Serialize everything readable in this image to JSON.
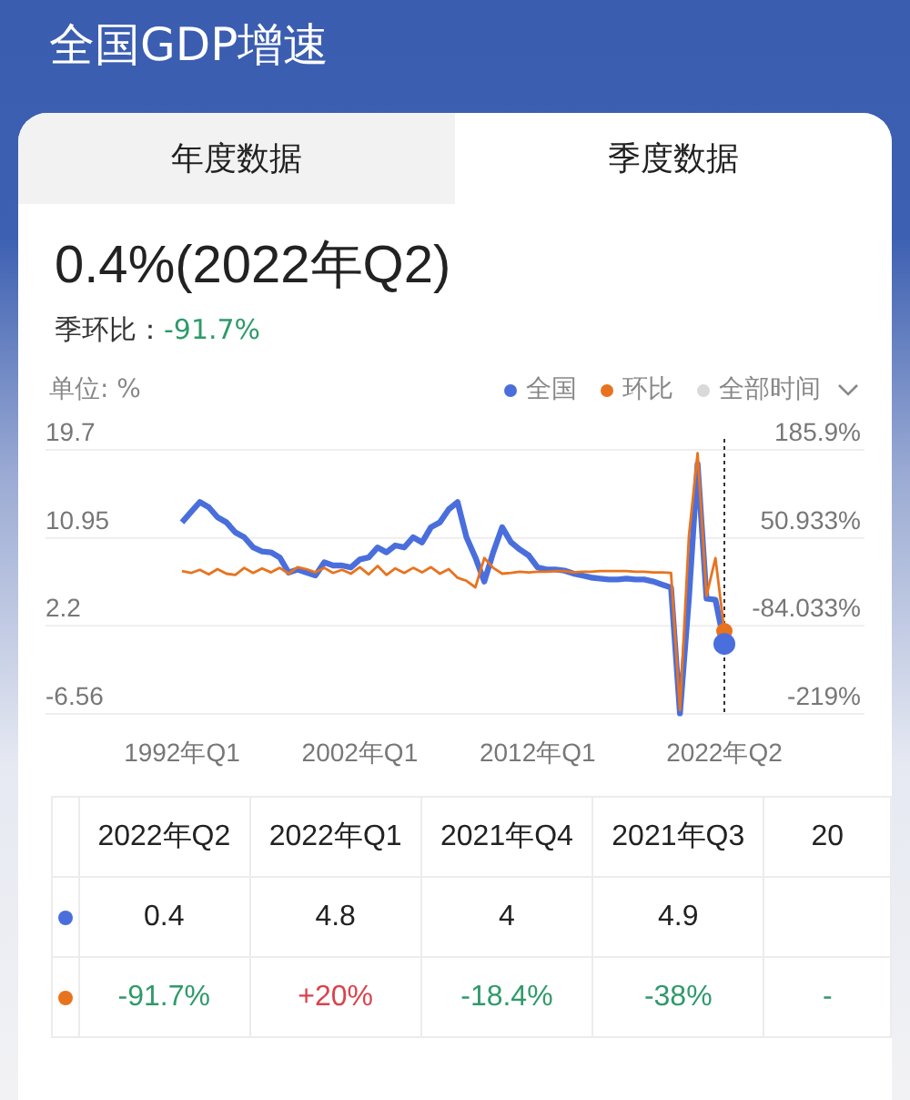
{
  "title": "全国GDP增速",
  "tabs": [
    {
      "label": "年度数据",
      "selected": false
    },
    {
      "label": "季度数据",
      "selected": true
    }
  ],
  "headline": "0.4%(2022年Q2)",
  "change": {
    "label": "季环比：",
    "value": "-91.7%",
    "color": "#2f9a6a"
  },
  "unit": "单位: %",
  "time_range": {
    "label": "全部时间",
    "color": "#d9d9d9"
  },
  "chart_data": {
    "type": "line",
    "categories": [
      "1992年Q1",
      null,
      null,
      null,
      null,
      null,
      null,
      null,
      null,
      null,
      null,
      null,
      null,
      null,
      null,
      null,
      null,
      null,
      null,
      null,
      "2002年Q1",
      null,
      null,
      null,
      null,
      null,
      null,
      null,
      null,
      null,
      null,
      null,
      null,
      null,
      null,
      null,
      null,
      null,
      null,
      null,
      "2012年Q1",
      null,
      null,
      null,
      null,
      null,
      null,
      null,
      null,
      null,
      null,
      null,
      null,
      null,
      null,
      null,
      null,
      null,
      null,
      null,
      null,
      "2022年Q2"
    ],
    "series": [
      {
        "name": "全国",
        "color": "#4a6fdc",
        "values": [
          12.5,
          13.5,
          14.5,
          14,
          13,
          12.5,
          11.5,
          11,
          10,
          9.6,
          9.5,
          9,
          7.5,
          7.8,
          7.5,
          7.2,
          8.5,
          8.2,
          8.2,
          8,
          8.8,
          9,
          10,
          9.5,
          10.2,
          10,
          11,
          10.5,
          12,
          12.5,
          13.8,
          14.5,
          11,
          9,
          6.6,
          9.5,
          12,
          10.5,
          9.8,
          9.2,
          8,
          7.8,
          7.8,
          7.7,
          7.4,
          7.2,
          7,
          6.9,
          6.8,
          6.8,
          6.9,
          6.8,
          6.8,
          6.6,
          6.3,
          6,
          -6.5,
          4.9,
          18.3,
          4.9,
          4.8,
          0.4
        ]
      },
      {
        "name": "环比",
        "color": "#e8731f",
        "axis": "y2",
        "values": [
          0,
          -3,
          2,
          -5,
          3,
          -4,
          -6,
          5,
          -3,
          4,
          -2,
          5,
          -4,
          6,
          3,
          -2,
          5,
          -3,
          2,
          -4,
          6,
          -5,
          8,
          -6,
          4,
          -3,
          5,
          -2,
          6,
          -4,
          3,
          -10,
          -15,
          -25,
          20,
          5,
          -4,
          -3,
          -1,
          -2,
          -1,
          -1,
          0,
          0,
          -2,
          -1,
          -1,
          0,
          0,
          0,
          0,
          -1,
          -1,
          -2,
          -2,
          -3,
          -213,
          53,
          181,
          -38,
          20,
          -92
        ]
      }
    ],
    "ylim": [
      -6.56,
      19.7
    ],
    "yticks": [
      19.7,
      10.95,
      2.2,
      -6.56
    ],
    "y2lim": [
      -219,
      185.9
    ],
    "y2ticks": [
      {
        "value": 185.9,
        "label": "185.9%"
      },
      {
        "value": 50.933,
        "label": "50.933%"
      },
      {
        "value": -84.033,
        "label": "-84.033%"
      },
      {
        "value": -219,
        "label": "-219%"
      }
    ]
  },
  "table": {
    "columns": [
      "2022年Q2",
      "2022年Q1",
      "2021年Q4",
      "2021年Q3",
      "20"
    ],
    "rows": [
      {
        "color": "#4a6fdc",
        "cells": [
          {
            "text": "0.4"
          },
          {
            "text": "4.8"
          },
          {
            "text": "4"
          },
          {
            "text": "4.9"
          }
        ]
      },
      {
        "color": "#e8731f",
        "cells": [
          {
            "text": "-91.7%",
            "color": "#2f9a6a"
          },
          {
            "text": "+20%",
            "color": "#d9434c"
          },
          {
            "text": "-18.4%",
            "color": "#2f9a6a"
          },
          {
            "text": "-38%",
            "color": "#2f9a6a"
          },
          {
            "text": "-",
            "color": "#2f9a6a"
          }
        ]
      }
    ]
  }
}
